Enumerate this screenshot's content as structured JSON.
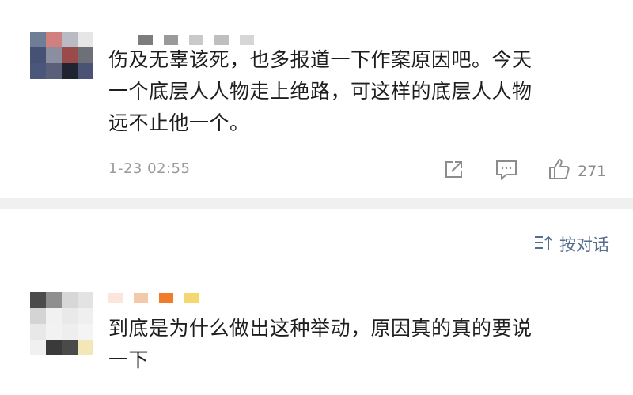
{
  "comments": [
    {
      "text": "伤及无辜该死，也多报道一下作案原因吧。今天\n一个底层人人物走上绝路，可这样的底层人人物\n远不止他一个。",
      "time": "1-23 02:55",
      "like_count": "271",
      "icons": [
        "share-icon",
        "comment-icon",
        "like-icon"
      ]
    },
    {
      "text": "到底是为什么做出这种举动，原因真的真的要说\n一下"
    }
  ],
  "thread_link": {
    "label": "按对话",
    "icon": "view-conversation-icon",
    "color": "#556e8f"
  },
  "colors": {
    "divider": "#f0f0f0",
    "time": "#9a9a9a",
    "link": "#556e8f"
  }
}
